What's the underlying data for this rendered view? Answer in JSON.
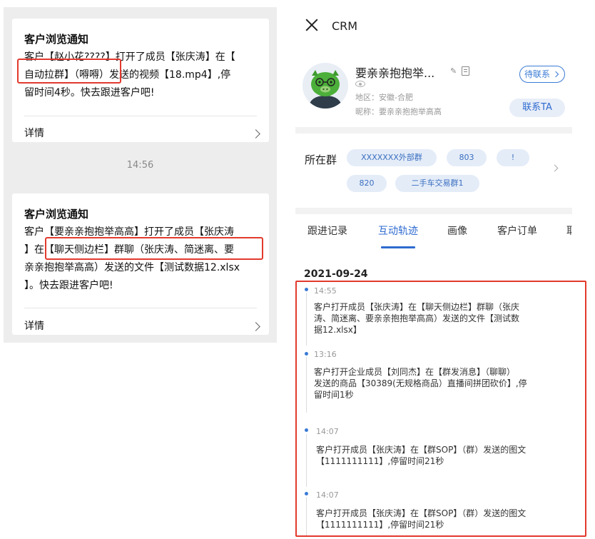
{
  "left_panel": {
    "cards": [
      {
        "title": "客户浏览通知",
        "lines": [
          "客户【赵小花????】打开了成员【张庆涛】在【",
          "自动拉群】（嘚嘚）发送的视频【18.mp4】,停",
          "留时间4秒。快去跟进客户吧!"
        ],
        "detail_label": "详情"
      },
      {
        "title": "客户浏览通知",
        "lines": [
          "客户【要亲亲抱抱举高高】打开了成员【张庆涛",
          "】在【聊天侧边栏】群聊（张庆涛、简迷离、要",
          "亲亲抱抱举高高）发送的文件【测试数据12.xlsx",
          "】。快去跟进客户吧!"
        ],
        "detail_label": "详情"
      }
    ],
    "time_separator": "14:56"
  },
  "right_panel": {
    "app_title": "CRM",
    "customer": {
      "name": "要亲亲抱抱举...",
      "region": "地区：安徽-合肥",
      "nickname": "昵称：要亲亲抱抱举高高",
      "pending_label": "待联系",
      "contact_label": "联系TA"
    },
    "groups": {
      "label": "所在群",
      "tags": [
        "XXXXXXX外部群",
        "803",
        "!",
        "820",
        "二手车交易群1"
      ]
    },
    "tabs": [
      "跟进记录",
      "互动轨迹",
      "画像",
      "客户订单",
      "耶"
    ],
    "active_tab": "互动轨迹",
    "timeline": {
      "date": "2021-09-24",
      "entries": [
        {
          "time": "14:55",
          "lines": [
            "客户打开成员【张庆涛】在【聊天侧边栏】群聊（张庆",
            "涛、简迷离、要亲亲抱抱举高高）发送的文件【测试数",
            "据12.xlsx】"
          ]
        },
        {
          "time": "13:16",
          "lines": [
            "客户打开企业成员【刘同杰】在【群发消息】（聊聊）",
            "发送的商品【30389(无规格商品）直播间拼团砍价】,停",
            "留时间1秒"
          ]
        },
        {
          "time": "14:07",
          "lines": [
            "客户打开成员【张庆涛】在【群SOP】（群）发送的图文",
            "【1111111111】,停留时间21秒"
          ]
        },
        {
          "time": "14:07",
          "lines": [
            "客户打开成员【张庆涛】在【群SOP】（群）发送的图文",
            "【1111111111】,停留时间21秒"
          ]
        }
      ]
    }
  },
  "colors": {
    "accent": "#2f6bd0",
    "highlight_red": "#e23a2e",
    "left_bg": "#ededed"
  }
}
